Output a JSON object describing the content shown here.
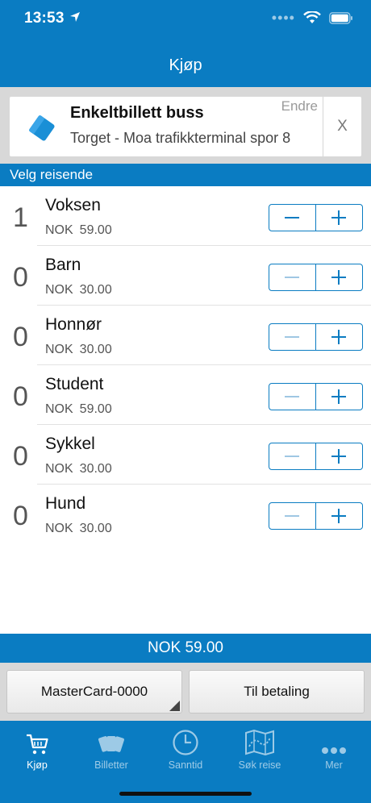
{
  "status_bar": {
    "time": "13:53"
  },
  "header": {
    "title": "Kjøp"
  },
  "ticket": {
    "title": "Enkeltbillett buss",
    "edit_label": "Endre",
    "route": "Torget - Moa trafikkterminal spor 8",
    "close_label": "X",
    "icon": "ticket-icon"
  },
  "section": {
    "label": "Velg reisende"
  },
  "travelers": [
    {
      "count": "1",
      "type": "Voksen",
      "currency": "NOK",
      "price": "59.00"
    },
    {
      "count": "0",
      "type": "Barn",
      "currency": "NOK",
      "price": "30.00"
    },
    {
      "count": "0",
      "type": "Honnør",
      "currency": "NOK",
      "price": "30.00"
    },
    {
      "count": "0",
      "type": "Student",
      "currency": "NOK",
      "price": "59.00"
    },
    {
      "count": "0",
      "type": "Sykkel",
      "currency": "NOK",
      "price": "30.00"
    },
    {
      "count": "0",
      "type": "Hund",
      "currency": "NOK",
      "price": "30.00"
    }
  ],
  "total": {
    "label": "NOK 59.00"
  },
  "actions": {
    "payment_method": "MasterCard-0000",
    "checkout": "Til betaling"
  },
  "tabs": [
    {
      "label": "Kjøp",
      "icon": "cart-icon",
      "active": true
    },
    {
      "label": "Billetter",
      "icon": "tickets-icon",
      "active": false
    },
    {
      "label": "Sanntid",
      "icon": "clock-icon",
      "active": false
    },
    {
      "label": "Søk reise",
      "icon": "map-icon",
      "active": false
    },
    {
      "label": "Mer",
      "icon": "more-icon",
      "active": false
    }
  ],
  "colors": {
    "brand": "#0a7cc2",
    "background": "#ffffff",
    "panel": "#d8d8d8"
  }
}
